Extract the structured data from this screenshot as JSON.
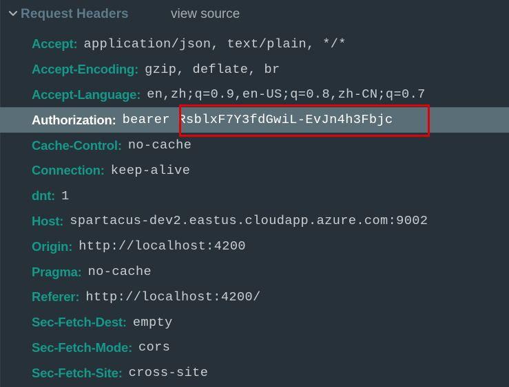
{
  "section": {
    "title": "Request Headers",
    "expanded": true,
    "view_source_label": "view source",
    "chevron_icon": "chevron-down-icon"
  },
  "colors": {
    "background": "#263139",
    "key": "#139a89",
    "value": "#c9ced2",
    "selected_row_bg": "#5a6e78",
    "header_title": "#5f7b8a",
    "highlight_border": "#e30000"
  },
  "headers": [
    {
      "key": "Accept:",
      "value": "application/json, text/plain, */*"
    },
    {
      "key": "Accept-Encoding:",
      "value": "gzip, deflate, br"
    },
    {
      "key": "Accept-Language:",
      "value": "en,zh;q=0.9,en-US;q=0.8,zh-CN;q=0.7"
    },
    {
      "key": "Authorization:",
      "value": "bearer RsblxF7Y3fdGwiL-EvJn4h3Fbjc",
      "selected": true,
      "highlighted_token": "RsblxF7Y3fdGwiL-EvJn4h3Fbjc"
    },
    {
      "key": "Cache-Control:",
      "value": "no-cache"
    },
    {
      "key": "Connection:",
      "value": "keep-alive"
    },
    {
      "key": "dnt:",
      "value": "1"
    },
    {
      "key": "Host:",
      "value": "spartacus-dev2.eastus.cloudapp.azure.com:9002"
    },
    {
      "key": "Origin:",
      "value": "http://localhost:4200"
    },
    {
      "key": "Pragma:",
      "value": "no-cache"
    },
    {
      "key": "Referer:",
      "value": "http://localhost:4200/"
    },
    {
      "key": "Sec-Fetch-Dest:",
      "value": "empty"
    },
    {
      "key": "Sec-Fetch-Mode:",
      "value": "cors"
    },
    {
      "key": "Sec-Fetch-Site:",
      "value": "cross-site"
    }
  ]
}
